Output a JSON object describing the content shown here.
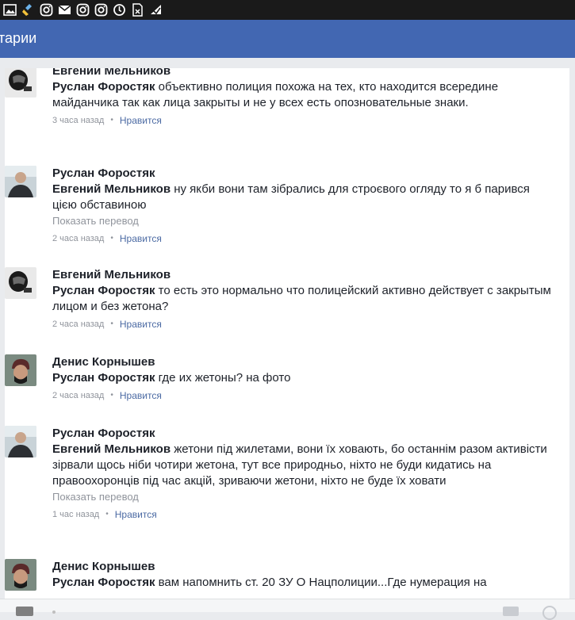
{
  "status_bar": {
    "icons": [
      "gallery-icon",
      "cleaner-icon",
      "instagram-icon",
      "gmail-icon",
      "instagram-icon",
      "instagram-icon",
      "sync-icon",
      "no-sim-icon",
      "data-saver-icon"
    ]
  },
  "app_bar": {
    "title": "тарии"
  },
  "comments": [
    {
      "author": "Евгении Мельников",
      "mention": "Руслан Форостяк",
      "text": " объективно полиция похожа на тех, кто находится всередине майданчика так как лица закрыты и не у всех есть опозновательные знаки.",
      "translate": "",
      "time": "3 часа назад",
      "like": "Нравится"
    },
    {
      "author": "Руслан Форостяк",
      "mention": "Евгений Мельников",
      "text": " ну якби вони там зібрались для строєвого огляду то я б парився цією обставиною",
      "translate": "Показать перевод",
      "time": "2 часа назад",
      "like": "Нравится"
    },
    {
      "author": "Евгений Мельников",
      "mention": "Руслан Форостяк",
      "text": " то есть это нормально что полицейский активно действует с закрытым лицом и без жетона?",
      "translate": "",
      "time": "2 часа назад",
      "like": "Нравится"
    },
    {
      "author": "Денис Корнышев",
      "mention": "Руслан Форостяк",
      "text": " где их жетоны? на фото",
      "translate": "",
      "time": "2 часа назад",
      "like": "Нравится"
    },
    {
      "author": "Руслан Форостяк",
      "mention": "Евгений Мельников",
      "text": " жетони під жилетами, вони їх ховають, бо останнім разом активісти зірвали щось ніби чотири жетона, тут все природньо, ніхто не буди кидатись на правоохоронців під час акцій, зриваючи жетони, ніхто не буде їх ховати",
      "translate": "Показать перевод",
      "time": "1 час назад",
      "like": "Нравится"
    },
    {
      "author": "Денис Корнышев",
      "mention": "Руслан Форостяк",
      "text": " вам напомнить ст. 20 ЗУ О Нацполиции...Где нумерация на",
      "translate": "",
      "time": "",
      "like": ""
    }
  ]
}
